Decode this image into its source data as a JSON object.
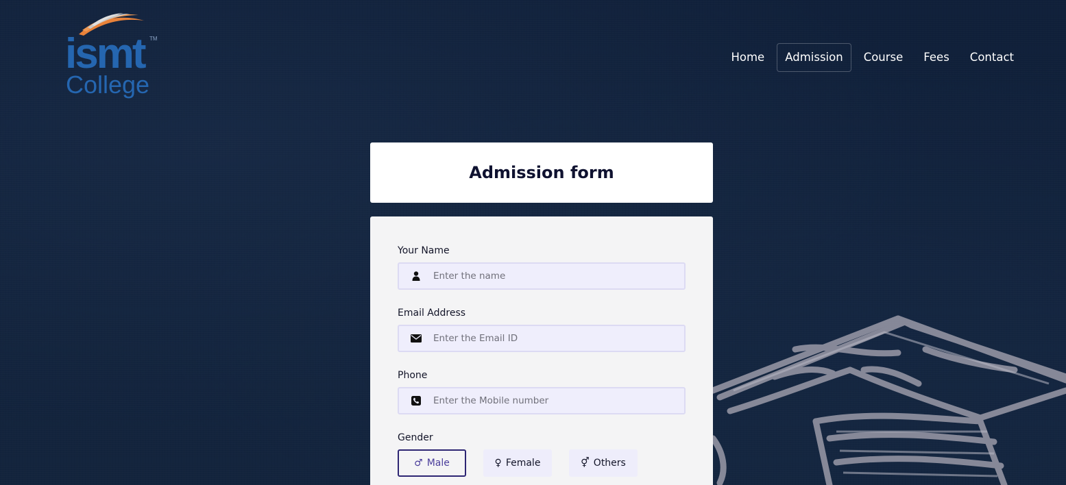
{
  "logo": {
    "brand": "ismt",
    "tm": "TM",
    "subtitle": "College",
    "colors": {
      "brand": "#2566b0",
      "swoosh": "#e8823a"
    }
  },
  "nav": {
    "items": [
      {
        "label": "Home",
        "active": false
      },
      {
        "label": "Admission",
        "active": true
      },
      {
        "label": "Course",
        "active": false
      },
      {
        "label": "Fees",
        "active": false
      },
      {
        "label": "Contact",
        "active": false
      }
    ]
  },
  "form": {
    "title": "Admission form",
    "name": {
      "label": "Your Name",
      "placeholder": "Enter the name",
      "value": "",
      "icon": "user-icon"
    },
    "email": {
      "label": "Email Address",
      "placeholder": "Enter the Email ID",
      "value": "",
      "icon": "envelope-icon"
    },
    "phone": {
      "label": "Phone",
      "placeholder": "Enter the Mobile number",
      "value": "",
      "icon": "phone-icon"
    },
    "gender": {
      "label": "Gender",
      "selected": "Male",
      "options": [
        {
          "label": "Male",
          "symbol": "♂",
          "icon": "male-icon"
        },
        {
          "label": "Female",
          "symbol": "♀",
          "icon": "female-icon"
        },
        {
          "label": "Others",
          "symbol": "⚥",
          "icon": "intersex-icon"
        }
      ]
    }
  },
  "colors": {
    "background": "#12223a",
    "card": "#ffffff",
    "form_body": "#f4f4f5",
    "input_bg": "#efeefc",
    "selected_border": "#2d2573"
  }
}
